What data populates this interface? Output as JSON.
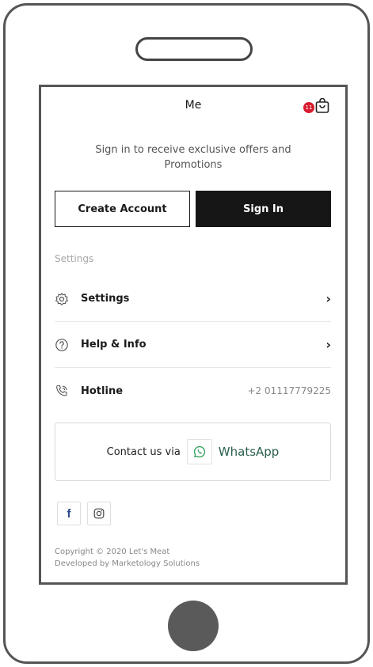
{
  "header": {
    "title": "Me",
    "cart_badge": "11"
  },
  "subtitle": "Sign in to receive exclusive offers and Promotions",
  "buttons": {
    "create_account": "Create Account",
    "sign_in": "Sign In"
  },
  "settings_section": {
    "label": "Settings",
    "rows": [
      {
        "label": "Settings",
        "icon": "gear-icon",
        "trailing": "›"
      },
      {
        "label": "Help & Info",
        "icon": "help-circle-icon",
        "trailing": "›"
      },
      {
        "label": "Hotline",
        "icon": "phone-icon",
        "value": "+2 01117779225"
      }
    ]
  },
  "contact": {
    "label": "Contact us via",
    "channel": "WhatsApp"
  },
  "social": {
    "facebook": "f"
  },
  "footer": {
    "copyright": "Copyright © 2020 Let's Meat",
    "developer": "Developed by Marketology Solutions"
  },
  "colors": {
    "badge": "#d81b2e",
    "primary_button": "#161616",
    "whatsapp_text": "#2a5f4f",
    "facebook": "#2a4a8a"
  }
}
